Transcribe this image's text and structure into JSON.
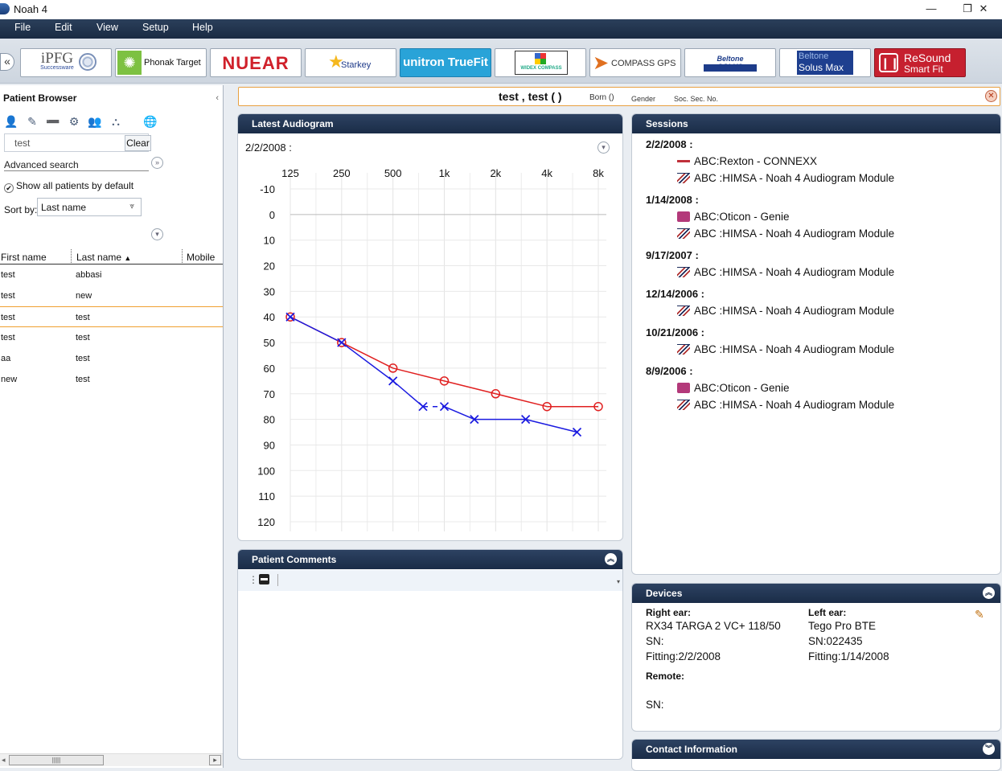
{
  "window": {
    "title": "Noah 4",
    "minimize": "—",
    "restore": "❐",
    "close": "✕"
  },
  "menu": [
    "File",
    "Edit",
    "View",
    "Setup",
    "Help"
  ],
  "modules": [
    {
      "id": "ipfg",
      "label": "iPFG",
      "sub": "Successware"
    },
    {
      "id": "phonak",
      "label": "Phonak Target"
    },
    {
      "id": "nuear",
      "label": "NUEAR"
    },
    {
      "id": "starkey",
      "label": "Starkey"
    },
    {
      "id": "unitron",
      "label": "unitron TrueFit"
    },
    {
      "id": "widex",
      "label": "WIDEX COMPASS"
    },
    {
      "id": "compass",
      "label": "COMPASS GPS"
    },
    {
      "id": "beltone1",
      "label": "Beltone SOLUS"
    },
    {
      "id": "beltone2",
      "label": "Beltone",
      "sub": "Solus Max"
    },
    {
      "id": "resound",
      "label": "ReSound",
      "sub": "Smart Fit"
    }
  ],
  "patient_browser": {
    "title": "Patient Browser",
    "search_value": "test",
    "clear_label": "Clear",
    "advanced_search": "Advanced search",
    "show_all": "Show all patients by default",
    "sort_label": "Sort by:",
    "sort_value": "Last name",
    "columns": [
      "First name",
      "Last name",
      "Mobile"
    ],
    "rows": [
      {
        "first": "test",
        "last": "abbasi"
      },
      {
        "first": "test",
        "last": "new"
      },
      {
        "first": "test",
        "last": "test"
      },
      {
        "first": "test",
        "last": "test"
      },
      {
        "first": "aa",
        "last": "test"
      },
      {
        "first": "new",
        "last": "test"
      }
    ],
    "selected_row": 2
  },
  "patient_header": {
    "name": "test ,  test  (  )",
    "born": "Born ()",
    "gender": "Gender",
    "ssn": "Soc. Sec. No."
  },
  "audiogram": {
    "panel_title": "Latest Audiogram",
    "date": "2/2/2008 :"
  },
  "chart_data": {
    "type": "line",
    "x_labels": [
      "125",
      "250",
      "500",
      "1k",
      "2k",
      "4k",
      "8k"
    ],
    "x_freqs": [
      125,
      250,
      500,
      1000,
      2000,
      4000,
      8000
    ],
    "y_labels": [
      "-10",
      "0",
      "10",
      "20",
      "30",
      "40",
      "50",
      "60",
      "70",
      "80",
      "90",
      "100",
      "110",
      "120"
    ],
    "ylim": [
      -10,
      120
    ],
    "y_inverted": true,
    "x_log": true,
    "grid": true,
    "series": [
      {
        "marker": "circle",
        "color": "#e02020",
        "x": [
          125,
          250,
          500,
          1000,
          2000,
          4000,
          8000
        ],
        "y": [
          40,
          50,
          60,
          65,
          70,
          75,
          75
        ]
      },
      {
        "marker": "x",
        "color": "#1a1ae0",
        "x": [
          125,
          250,
          500,
          750,
          1000,
          1500,
          3000,
          6000
        ],
        "y": [
          40,
          50,
          65,
          75,
          75,
          80,
          80,
          85
        ],
        "dashed_segment": [
          3,
          4
        ]
      }
    ]
  },
  "comments": {
    "panel_title": "Patient Comments"
  },
  "sessions": {
    "panel_title": "Sessions",
    "groups": [
      {
        "date": "2/2/2008 :",
        "items": [
          {
            "icon": "rexton",
            "text": "ABC:Rexton - CONNEXX"
          },
          {
            "icon": "himsa",
            "text": "ABC :HIMSA  - Noah 4 Audiogram Module"
          }
        ]
      },
      {
        "date": "1/14/2008 :",
        "items": [
          {
            "icon": "oticon",
            "text": "ABC:Oticon - Genie"
          },
          {
            "icon": "himsa",
            "text": "ABC :HIMSA  - Noah 4 Audiogram Module"
          }
        ]
      },
      {
        "date": "9/17/2007 :",
        "items": [
          {
            "icon": "himsa",
            "text": "ABC :HIMSA  - Noah 4 Audiogram Module"
          }
        ]
      },
      {
        "date": "12/14/2006 :",
        "items": [
          {
            "icon": "himsa",
            "text": "ABC :HIMSA  - Noah 4 Audiogram Module"
          }
        ]
      },
      {
        "date": "10/21/2006 :",
        "items": [
          {
            "icon": "himsa",
            "text": "ABC :HIMSA  - Noah 4 Audiogram Module"
          }
        ]
      },
      {
        "date": "8/9/2006 :",
        "items": [
          {
            "icon": "oticon",
            "text": "ABC:Oticon - Genie"
          },
          {
            "icon": "himsa",
            "text": "ABC :HIMSA  - Noah 4 Audiogram Module"
          }
        ]
      }
    ]
  },
  "devices": {
    "panel_title": "Devices",
    "right_label": "Right ear:",
    "right_model": "RX34 TARGA 2 VC+ 118/50",
    "right_sn": "SN:",
    "right_fitting": "Fitting:2/2/2008",
    "left_label": "Left ear:",
    "left_model": "Tego Pro BTE",
    "left_sn": "SN:022435",
    "left_fitting": "Fitting:1/14/2008",
    "remote_label": "Remote:",
    "remote_sn": "SN:"
  },
  "contact": {
    "panel_title": "Contact Information"
  }
}
